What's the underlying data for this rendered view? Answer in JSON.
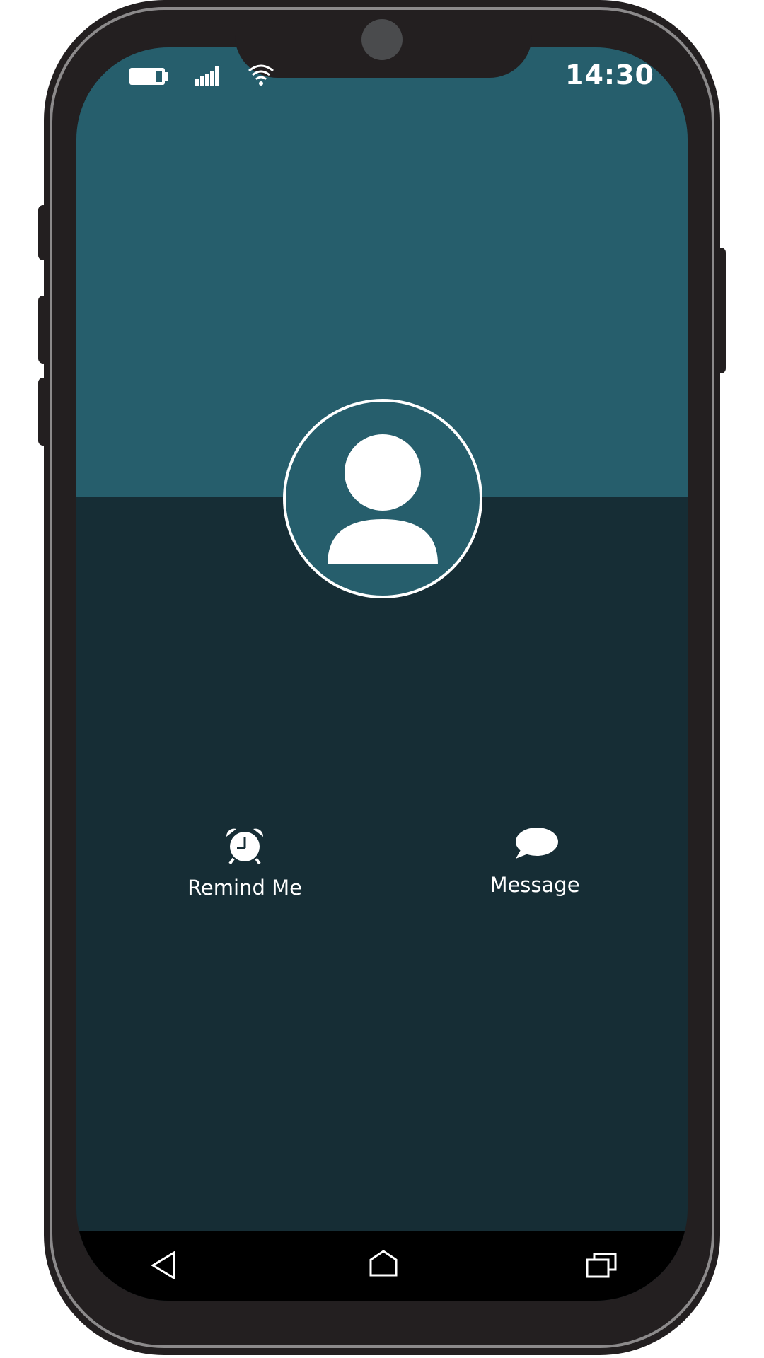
{
  "status_bar": {
    "time": "14:30",
    "icons": [
      "battery-icon",
      "signal-icon",
      "wifi-icon"
    ]
  },
  "caller": {
    "avatar_icon": "person-icon"
  },
  "actions": [
    {
      "label": "Remind Me",
      "icon": "alarm-clock-icon"
    },
    {
      "label": "Message",
      "icon": "chat-bubble-icon"
    }
  ],
  "nav_bar": {
    "buttons": [
      "back-icon",
      "home-icon",
      "recent-apps-icon"
    ]
  },
  "colors": {
    "header": "#265e6c",
    "body": "#162d35",
    "frame": "#231f20",
    "navbar": "#000000"
  }
}
